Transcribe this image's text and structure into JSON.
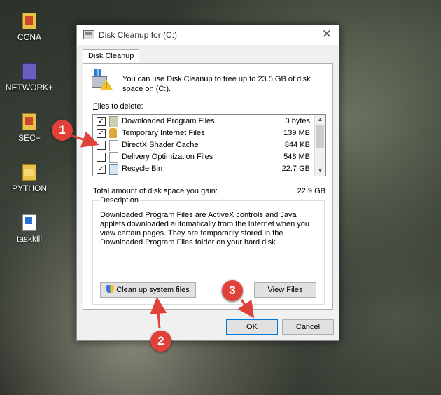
{
  "desktop": {
    "icons": [
      {
        "label": "CCNA",
        "icon": "winrar-archive-icon"
      },
      {
        "label": "NETWORK+",
        "icon": "winrar-archive-icon"
      },
      {
        "label": "SEC+",
        "icon": "winrar-archive-icon"
      },
      {
        "label": "PYTHON",
        "icon": "folder-icon"
      },
      {
        "label": "taskkill",
        "icon": "shortcut-icon"
      }
    ]
  },
  "dialog": {
    "title": "Disk Cleanup for  (C:)",
    "close_glyph": "✕",
    "tab_label": "Disk Cleanup",
    "info_text": "You can use Disk Cleanup to free up to 23.5 GB of disk space on  (C:).",
    "files_label_prefix": "F",
    "files_label_rest": "iles to delete:",
    "files": [
      {
        "name": "Downloaded Program Files",
        "size": "0 bytes",
        "checked": true,
        "icon": "folder-icon"
      },
      {
        "name": "Temporary Internet Files",
        "size": "139 MB",
        "checked": true,
        "icon": "lock-icon"
      },
      {
        "name": "DirectX Shader Cache",
        "size": "844 KB",
        "checked": false,
        "icon": "page-icon"
      },
      {
        "name": "Delivery Optimization Files",
        "size": "548 MB",
        "checked": false,
        "icon": "page-icon"
      },
      {
        "name": "Recycle Bin",
        "size": "22.7 GB",
        "checked": true,
        "icon": "recycle-bin-icon"
      }
    ],
    "total_label": "Total amount of disk space you gain:",
    "total_value": "22.9 GB",
    "description_legend": "Description",
    "description_text": "Downloaded Program Files are ActiveX controls and Java applets downloaded automatically from the Internet when you view certain pages. They are temporarily stored in the Downloaded Program Files folder on your hard disk.",
    "cleanup_button": "Clean up system files",
    "view_files_button": "View Files",
    "ok_button": "OK",
    "cancel_button": "Cancel"
  },
  "annotations": {
    "badges": [
      "1",
      "2",
      "3"
    ],
    "color": "#e0413b"
  }
}
